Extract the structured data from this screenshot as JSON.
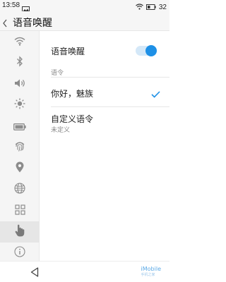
{
  "status_bar": {
    "time": "13:58",
    "battery": "32",
    "icons": [
      "image-notification-icon",
      "wifi-icon",
      "battery-icon"
    ]
  },
  "header": {
    "title": "语音唤醒",
    "back_icon": "chevron-left-icon"
  },
  "sidebar": {
    "items": [
      {
        "icon": "wifi-icon",
        "selected": false
      },
      {
        "icon": "bluetooth-icon",
        "selected": false
      },
      {
        "icon": "speaker-icon",
        "selected": false
      },
      {
        "icon": "brightness-icon",
        "selected": false
      },
      {
        "icon": "battery-icon",
        "selected": false
      },
      {
        "icon": "fingerprint-icon",
        "selected": false
      },
      {
        "icon": "location-pin-icon",
        "selected": false
      },
      {
        "icon": "globe-icon",
        "selected": false
      },
      {
        "icon": "apps-grid-icon",
        "selected": false
      },
      {
        "icon": "hand-pointer-icon",
        "selected": true
      },
      {
        "icon": "info-icon",
        "selected": false
      }
    ]
  },
  "main": {
    "voice_wake": {
      "label": "语音唤醒",
      "enabled": true
    },
    "section_header": "语令",
    "options": [
      {
        "label": "你好，魅族",
        "checked": true
      },
      {
        "label": "自定义语令",
        "subtitle": "未定义",
        "checked": false
      }
    ]
  },
  "nav_bar": {
    "back_icon": "triangle-back-icon",
    "watermark": "iMobile",
    "watermark_sub": "手机之家"
  },
  "colors": {
    "accent": "#1e90e6",
    "background": "#ffffff",
    "sidebar_bg": "#f5f5f5",
    "selected_bg": "#e6e6e6",
    "icon_gray": "#8c8c8c"
  }
}
